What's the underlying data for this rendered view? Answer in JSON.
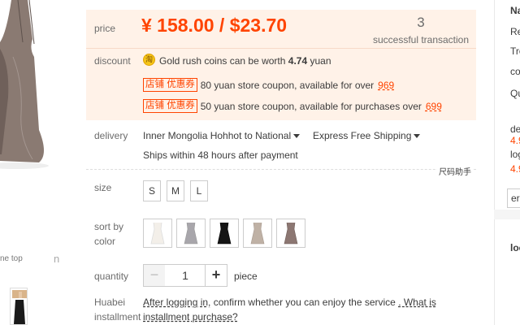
{
  "gallery": {
    "caption": "ne top",
    "next_glyph": "n"
  },
  "price": {
    "label": "price",
    "value": "¥ 158.00 / $23.70",
    "transaction_count": "3",
    "transaction_label": "successful transaction"
  },
  "discount": {
    "label": "discount",
    "coin_icon_glyph": "淘",
    "coin_text_prefix": "Gold rush coins can be worth",
    "coin_amount": "4.74",
    "coin_text_suffix": "yuan",
    "coupons": [
      {
        "tag": "店铺 优惠券",
        "text": "80 yuan store coupon, available for over",
        "threshold": "969"
      },
      {
        "tag": "店铺 优惠券",
        "text": "50 yuan store coupon, available for purchases over",
        "threshold": "699"
      }
    ]
  },
  "delivery": {
    "label": "delivery",
    "route": "Inner Mongolia Hohhot to National",
    "shipping": "Express Free Shipping",
    "ships_within": "Ships within 48 hours after payment",
    "size_helper": "尺码助手"
  },
  "size": {
    "label": "size",
    "options": [
      "S",
      "M",
      "L"
    ]
  },
  "color": {
    "label": "sort by color",
    "swatches": [
      {
        "name": "white",
        "hex": "#f3efe9"
      },
      {
        "name": "grey",
        "hex": "#a8a6ab"
      },
      {
        "name": "black",
        "hex": "#151515"
      },
      {
        "name": "beige",
        "hex": "#bfb1a5"
      },
      {
        "name": "brown",
        "hex": "#8c7772"
      }
    ]
  },
  "quantity": {
    "label": "quantity",
    "minus": "−",
    "value": "1",
    "plus": "+",
    "unit": "piece"
  },
  "huabei": {
    "label": "Huabei installment",
    "login_text": "After logging in,",
    "confirm_text": "confirm whether you can enjoy the service",
    "link_text": ". What is installment purchase?"
  },
  "sidebar": {
    "lines": [
      "Na",
      "Re",
      "Tre",
      "co",
      "Qu"
    ],
    "rating_label_1": "de",
    "rating_value_1": "4.9",
    "rating_label_2": "log",
    "rating_value_2": "4.9",
    "button_text": "er",
    "bottom_text": "loc"
  },
  "colors": {
    "accent": "#ff4400",
    "price_bg": "#fff2e8",
    "coin": "#f5c518"
  }
}
